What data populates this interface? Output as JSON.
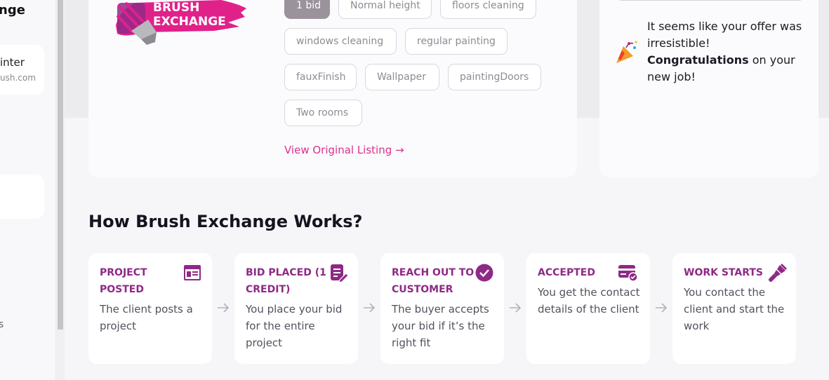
{
  "sidebar": {
    "title_fragment": "nge",
    "card_line1": "inter",
    "card_line2": "ush.com",
    "stray_text": "s"
  },
  "listing": {
    "logo_line1": "BRUSH",
    "logo_line2": "EXCHANGE",
    "chips": [
      "1 bid",
      "Normal height",
      "floors cleaning",
      "windows cleaning",
      "regular painting",
      "fauxFinish",
      "Wallpaper",
      "paintingDoors",
      "Two rooms"
    ],
    "view_link": "View Original Listing →"
  },
  "congrats": {
    "line1": "It seems like your offer was irresistible!",
    "bold": "Congratulations",
    "line2": " on your new job!"
  },
  "how": {
    "title": "How Brush Exchange Works?",
    "steps": [
      {
        "title": "PROJECT POSTED",
        "desc": "The client posts a project",
        "icon": "listing-icon"
      },
      {
        "title": "BID PLACED (1 CREDIT)",
        "desc": "You place your bid for the entire project",
        "icon": "edit-document-icon"
      },
      {
        "title": "REACH OUT TO CUSTOMER",
        "desc": "The buyer accepts your bid if it’s the right fit",
        "icon": "check-circle-icon"
      },
      {
        "title": "ACCEPTED",
        "desc": "You get the contact details of the client",
        "icon": "card-check-icon"
      },
      {
        "title": "WORK STARTS",
        "desc": "You contact the client and start the work",
        "icon": "paintbrush-icon"
      }
    ]
  },
  "colors": {
    "accent": "#8e2a86",
    "link": "#d8328c",
    "logo_pink": "#e0218a"
  }
}
